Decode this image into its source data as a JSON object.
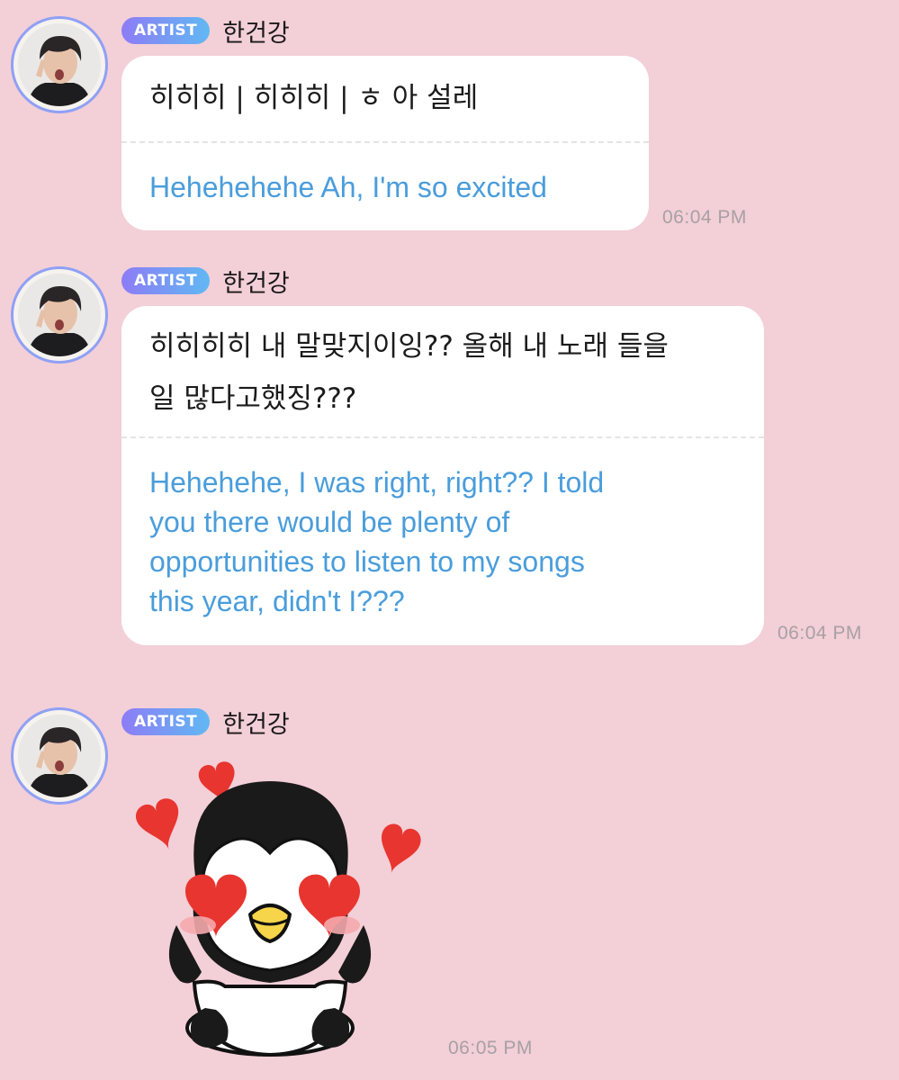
{
  "messages": [
    {
      "badge": "ARTIST",
      "sender": "한건강",
      "original": [
        "히히히 | 히히히 | ㅎ 아 설레"
      ],
      "translation": [
        "Hehehehehe Ah, I'm so excited"
      ],
      "time": "06:04 PM"
    },
    {
      "badge": "ARTIST",
      "sender": "한건강",
      "original": [
        "히히히히 내 말맞지이잉?? 올해 내 노래 들을",
        "일 많다고했징???"
      ],
      "translation": [
        "Hehehehe, I was right, right?? I told",
        "you there would be plenty of",
        "opportunities to listen to my songs",
        "this year, didn't I???"
      ],
      "time": "06:04 PM"
    },
    {
      "badge": "ARTIST",
      "sender": "한건강",
      "sticker": "penguin-heart-eyes-sticker",
      "time": "06:05 PM"
    }
  ],
  "colors": {
    "background": "#f3cfd7",
    "badge_gradient_start": "#8d7cf6",
    "badge_gradient_end": "#61b8f3",
    "translation_text": "#4a9ddb",
    "timestamp": "#a7a1a4",
    "heart": "#e8352f"
  }
}
